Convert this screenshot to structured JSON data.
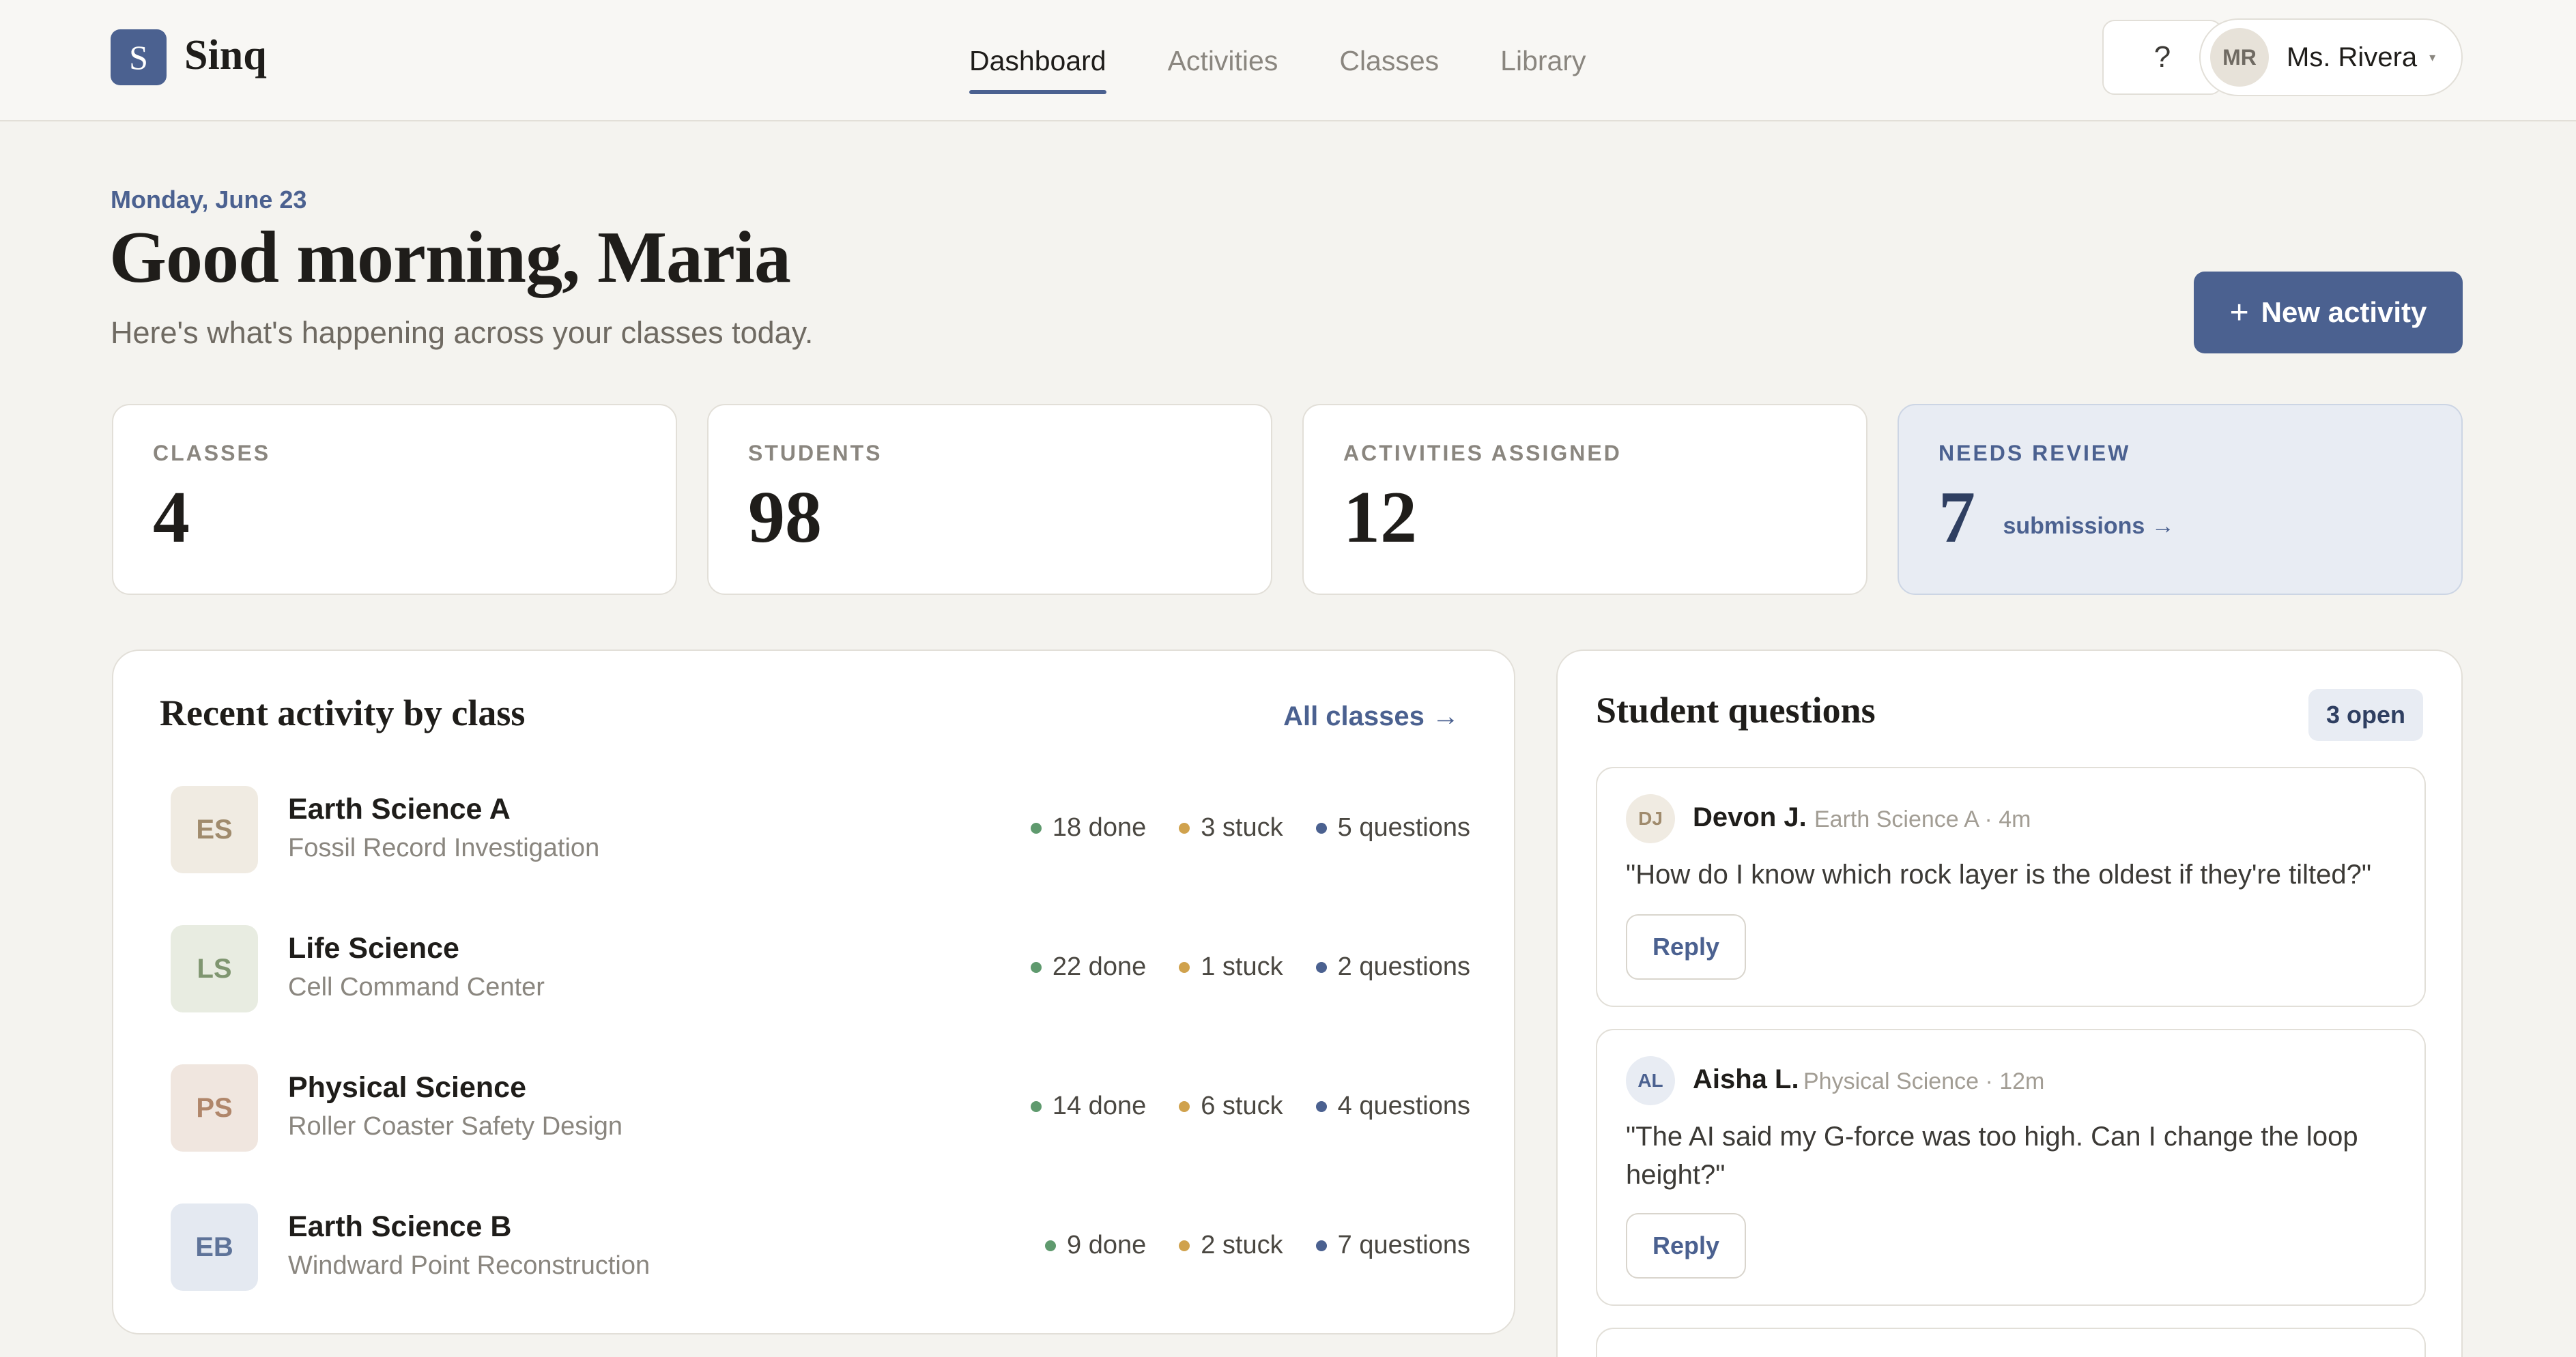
{
  "app": {
    "logo_letter": "S",
    "name": "Sinq"
  },
  "nav": {
    "items": [
      {
        "label": "Dashboard",
        "active": true
      },
      {
        "label": "Activities",
        "active": false
      },
      {
        "label": "Classes",
        "active": false
      },
      {
        "label": "Library",
        "active": false
      }
    ]
  },
  "header": {
    "help_label": "?",
    "user": {
      "initials": "MR",
      "name": "Ms. Rivera",
      "caret": "▾"
    }
  },
  "greeting": {
    "date": "Monday, June 23",
    "title": "Good morning, Maria",
    "subtitle": "Here's what's happening across your classes today.",
    "new_activity_icon": "+",
    "new_activity_label": "New activity"
  },
  "stats": [
    {
      "label": "CLASSES",
      "value": "4"
    },
    {
      "label": "STUDENTS",
      "value": "98"
    },
    {
      "label": "ACTIVITIES ASSIGNED",
      "value": "12"
    },
    {
      "label": "NEEDS REVIEW",
      "value": "7",
      "link": "submissions →"
    }
  ],
  "recent": {
    "title": "Recent activity by class",
    "link": "All classes →",
    "classes": [
      {
        "initials": "ES",
        "name": "Earth Science A",
        "activity": "Fossil Record Investigation",
        "done": "18 done",
        "stuck": "3 stuck",
        "questions": "5 questions",
        "badge_bg": "#f0ebe2",
        "badge_fg": "#a08b6d"
      },
      {
        "initials": "LS",
        "name": "Life Science",
        "activity": "Cell Command Center",
        "done": "22 done",
        "stuck": "1 stuck",
        "questions": "2 questions",
        "badge_bg": "#e8ece1",
        "badge_fg": "#7f9670"
      },
      {
        "initials": "PS",
        "name": "Physical Science",
        "activity": "Roller Coaster Safety Design",
        "done": "14 done",
        "stuck": "6 stuck",
        "questions": "4 questions",
        "badge_bg": "#f0e6df",
        "badge_fg": "#b0866a"
      },
      {
        "initials": "EB",
        "name": "Earth Science B",
        "activity": "Windward Point Reconstruction",
        "done": "9 done",
        "stuck": "2 stuck",
        "questions": "7 questions",
        "badge_bg": "#e4e9f1",
        "badge_fg": "#5e7399"
      }
    ]
  },
  "questions": {
    "title": "Student questions",
    "open_badge": "3 open",
    "items": [
      {
        "initials": "DJ",
        "name": "Devon J.",
        "meta": "Earth Science A · 4m",
        "text": "\"How do I know which rock layer is the oldest if they're tilted?\"",
        "reply_label": "Reply",
        "avatar_bg": "#f0ebe2",
        "avatar_fg": "#a08b6d"
      },
      {
        "initials": "AL",
        "name": "Aisha L.",
        "meta": "Physical Science · 12m",
        "text": "\"The AI said my G-force was too high. Can I change the loop height?\"",
        "reply_label": "Reply",
        "avatar_bg": "#e8ecf3",
        "avatar_fg": "#4b6190"
      }
    ]
  },
  "colors": {
    "accent": "#4b6190",
    "done_dot": "#5f9a6e",
    "stuck_dot": "#d0a24d",
    "questions_dot": "#4b6190"
  }
}
